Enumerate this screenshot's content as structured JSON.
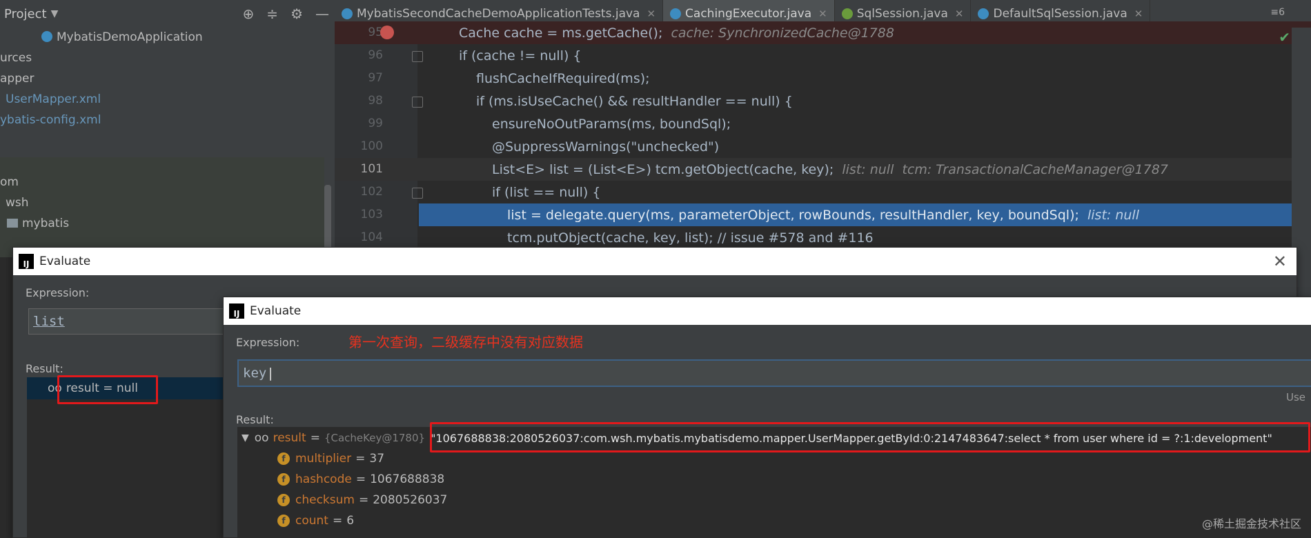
{
  "project_header": {
    "title": "Project"
  },
  "tabs": [
    {
      "label": "MybatisSecondCacheDemoApplicationTests.java",
      "color": "#3d8cc0"
    },
    {
      "label": "CachingExecutor.java",
      "color": "#3d8cc0"
    },
    {
      "label": "SqlSession.java",
      "color": "#6a9b3c"
    },
    {
      "label": "DefaultSqlSession.java",
      "color": "#3d8cc0"
    }
  ],
  "tab_menu": "≡6",
  "tree": {
    "items": [
      "MybatisDemoApplication",
      "urces",
      "apper",
      "UserMapper.xml",
      "ybatis-config.xml",
      "om",
      "wsh",
      "mybatis"
    ]
  },
  "code": {
    "lines": [
      {
        "num": "95",
        "text": "Cache cache = ms.getCache();",
        "hint": "cache: SynchronizedCache@1788"
      },
      {
        "num": "96",
        "text": "if (cache != null) {"
      },
      {
        "num": "97",
        "text": "flushCacheIfRequired(ms);"
      },
      {
        "num": "98",
        "text": "if (ms.isUseCache() && resultHandler == null) {"
      },
      {
        "num": "99",
        "text": "ensureNoOutParams(ms, boundSql);"
      },
      {
        "num": "100",
        "text": "@SuppressWarnings(\"unchecked\")"
      },
      {
        "num": "101",
        "text": "List<E> list = (List<E>) tcm.getObject(cache, key);",
        "hint": "list: null  tcm: TransactionalCacheManager@1787"
      },
      {
        "num": "102",
        "text": "if (list == null) {"
      },
      {
        "num": "103",
        "text": "list = delegate.query(ms, parameterObject, rowBounds, resultHandler, key, boundSql);",
        "hint": "list: null"
      },
      {
        "num": "104",
        "text": "tcm.putObject(cache, key, list); // issue #578 and #116"
      }
    ]
  },
  "dialog1": {
    "title": "Evaluate",
    "expression_label": "Expression:",
    "expression": "list",
    "result_label": "Result:",
    "result": "result = null"
  },
  "dialog2": {
    "title": "Evaluate",
    "expression_label": "Expression:",
    "annotation": "第一次查询，二级缓存中没有对应数据",
    "expression": "key",
    "use_hint": "Use",
    "result_label": "Result:",
    "result_name": "result",
    "result_ref": "{CacheKey@1780}",
    "result_value": "\"1067688838:2080526037:com.wsh.mybatis.mybatisdemo.mapper.UserMapper.getById:0:2147483647:select * from user where id = ?:1:development\"",
    "fields": [
      {
        "name": "multiplier",
        "value": "37"
      },
      {
        "name": "hashcode",
        "value": "1067688838"
      },
      {
        "name": "checksum",
        "value": "2080526037"
      },
      {
        "name": "count",
        "value": "6"
      }
    ]
  },
  "watermark": "@稀土掘金技术社区"
}
